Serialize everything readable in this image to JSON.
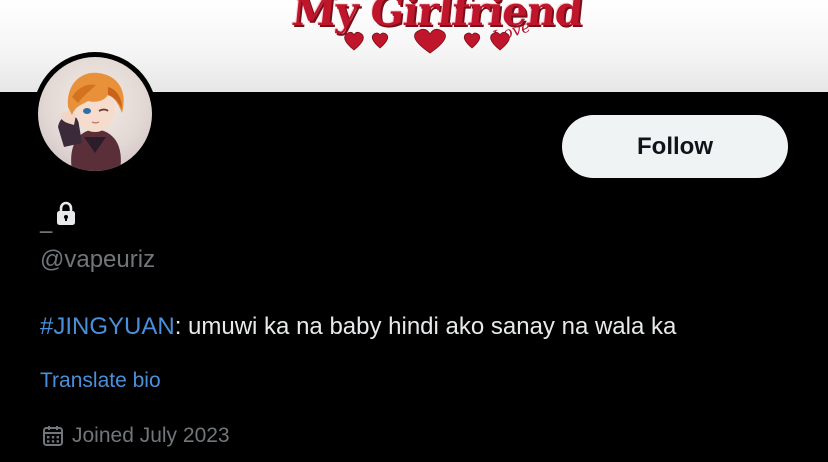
{
  "banner": {
    "logo_text": "My Girlfriend",
    "logo_sub": "Love",
    "accent_color": "#c0162c"
  },
  "profile": {
    "display_name": "_",
    "protected_icon": "lock-icon",
    "handle": "@vapeuriz",
    "bio": {
      "hashtag": "#JINGYUAN",
      "text": ": umuwi ka na baby hindi ako sanay na wala ka"
    },
    "translate_label": "Translate bio",
    "joined_icon": "calendar-icon",
    "joined": "Joined July 2023"
  },
  "actions": {
    "follow_label": "Follow"
  },
  "colors": {
    "background": "#000000",
    "primary_text": "#e7e9ea",
    "secondary_text": "#71767b",
    "link": "#4a8fd9",
    "follow_button_bg": "#eff3f4"
  }
}
